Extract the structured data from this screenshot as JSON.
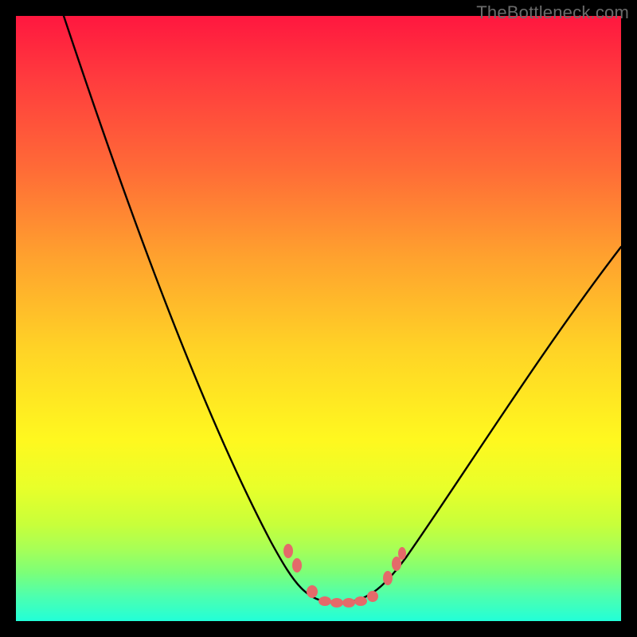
{
  "watermark": "TheBottleneck.com",
  "chart_data": {
    "type": "line",
    "title": "",
    "xlabel": "",
    "ylabel": "",
    "xlim": [
      0,
      100
    ],
    "ylim": [
      0,
      100
    ],
    "description": "Bottleneck curve: V-shape with minimum near optimal configuration; background gradient red (high bottleneck) to green (low bottleneck).",
    "series": [
      {
        "name": "bottleneck-curve",
        "x": [
          8,
          12,
          18,
          24,
          30,
          36,
          42,
          46,
          49,
          52,
          56,
          60,
          63,
          68,
          74,
          82,
          90,
          100
        ],
        "values": [
          100,
          90,
          76,
          62,
          48,
          35,
          22,
          12,
          6,
          3,
          3,
          5,
          8,
          14,
          23,
          35,
          47,
          62
        ]
      }
    ],
    "markers": {
      "name": "highlighted-points",
      "color": "#e46a6a",
      "points": [
        {
          "x": 45,
          "y": 11
        },
        {
          "x": 46.5,
          "y": 9
        },
        {
          "x": 49,
          "y": 4.5
        },
        {
          "x": 51,
          "y": 3
        },
        {
          "x": 53,
          "y": 3
        },
        {
          "x": 55,
          "y": 3
        },
        {
          "x": 57,
          "y": 3.2
        },
        {
          "x": 59,
          "y": 4
        },
        {
          "x": 61.5,
          "y": 7
        },
        {
          "x": 63,
          "y": 9.5
        },
        {
          "x": 63.8,
          "y": 11
        }
      ]
    },
    "gradient_stops": [
      {
        "pos": 0,
        "color": "#ff173f",
        "meaning": "high-bottleneck"
      },
      {
        "pos": 50,
        "color": "#ffd326",
        "meaning": "medium-bottleneck"
      },
      {
        "pos": 100,
        "color": "#22ffd8",
        "meaning": "no-bottleneck"
      }
    ]
  }
}
